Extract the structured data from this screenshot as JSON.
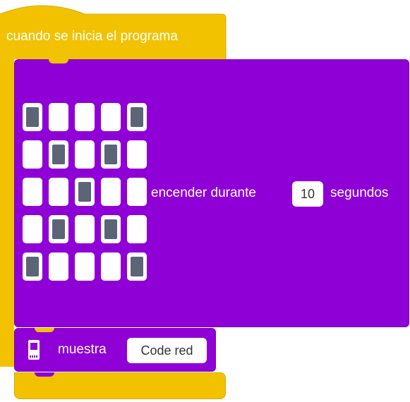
{
  "hat_block": {
    "label": "cuando se inicia el programa",
    "color": "#f2c200"
  },
  "led_block": {
    "label_before": "encender durante",
    "duration_value": "10",
    "label_after": "segundos",
    "color": "#8f00d6",
    "led_matrix": [
      [
        1,
        0,
        0,
        0,
        1
      ],
      [
        0,
        1,
        0,
        1,
        0
      ],
      [
        0,
        0,
        1,
        0,
        0
      ],
      [
        0,
        1,
        0,
        1,
        0
      ],
      [
        1,
        0,
        0,
        0,
        1
      ]
    ]
  },
  "show_block": {
    "icon": "microbit-icon",
    "label": "muestra",
    "text_value": "Code red"
  }
}
